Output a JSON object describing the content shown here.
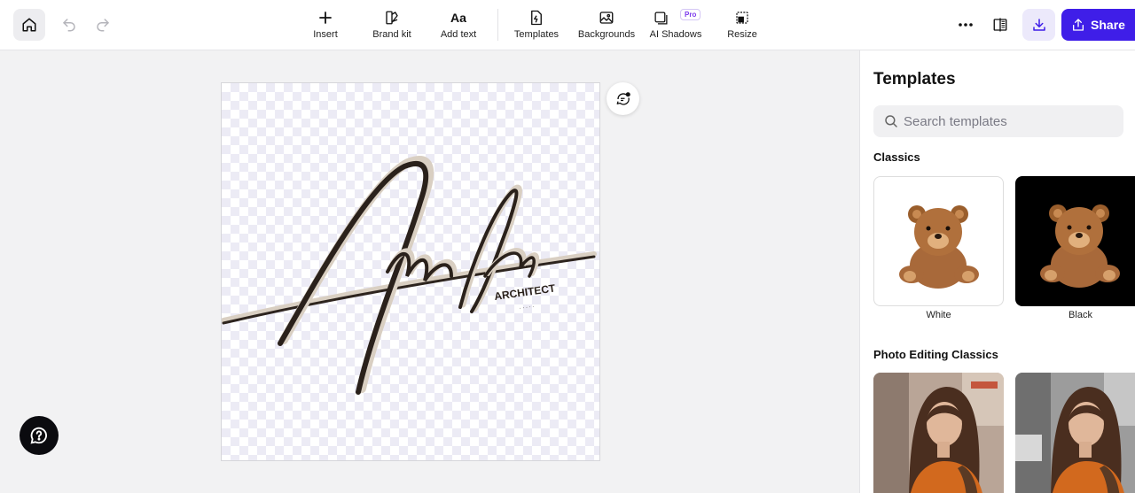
{
  "toolbar": {
    "tools": [
      {
        "label": "Insert",
        "icon": "plus-icon"
      },
      {
        "label": "Brand kit",
        "icon": "brand-kit-icon"
      },
      {
        "label": "Add text",
        "icon": "text-icon"
      },
      {
        "label": "Templates",
        "icon": "templates-icon"
      },
      {
        "label": "Backgrounds",
        "icon": "backgrounds-icon"
      },
      {
        "label": "AI Shadows",
        "icon": "ai-shadows-icon"
      },
      {
        "label": "Resize",
        "icon": "resize-icon"
      }
    ],
    "pro_badge": "Pro",
    "share_label": "Share"
  },
  "canvas": {
    "signature_text": "Amelia",
    "subtitle_text": "ARCHITECT"
  },
  "panel": {
    "title": "Templates",
    "search_placeholder": "Search templates",
    "sections": [
      {
        "title": "Classics",
        "items": [
          {
            "label": "White"
          },
          {
            "label": "Black"
          }
        ]
      },
      {
        "title": "Photo Editing Classics",
        "items": []
      }
    ]
  },
  "colors": {
    "accent": "#3f1ee8",
    "accent_light": "#ece9fb"
  }
}
